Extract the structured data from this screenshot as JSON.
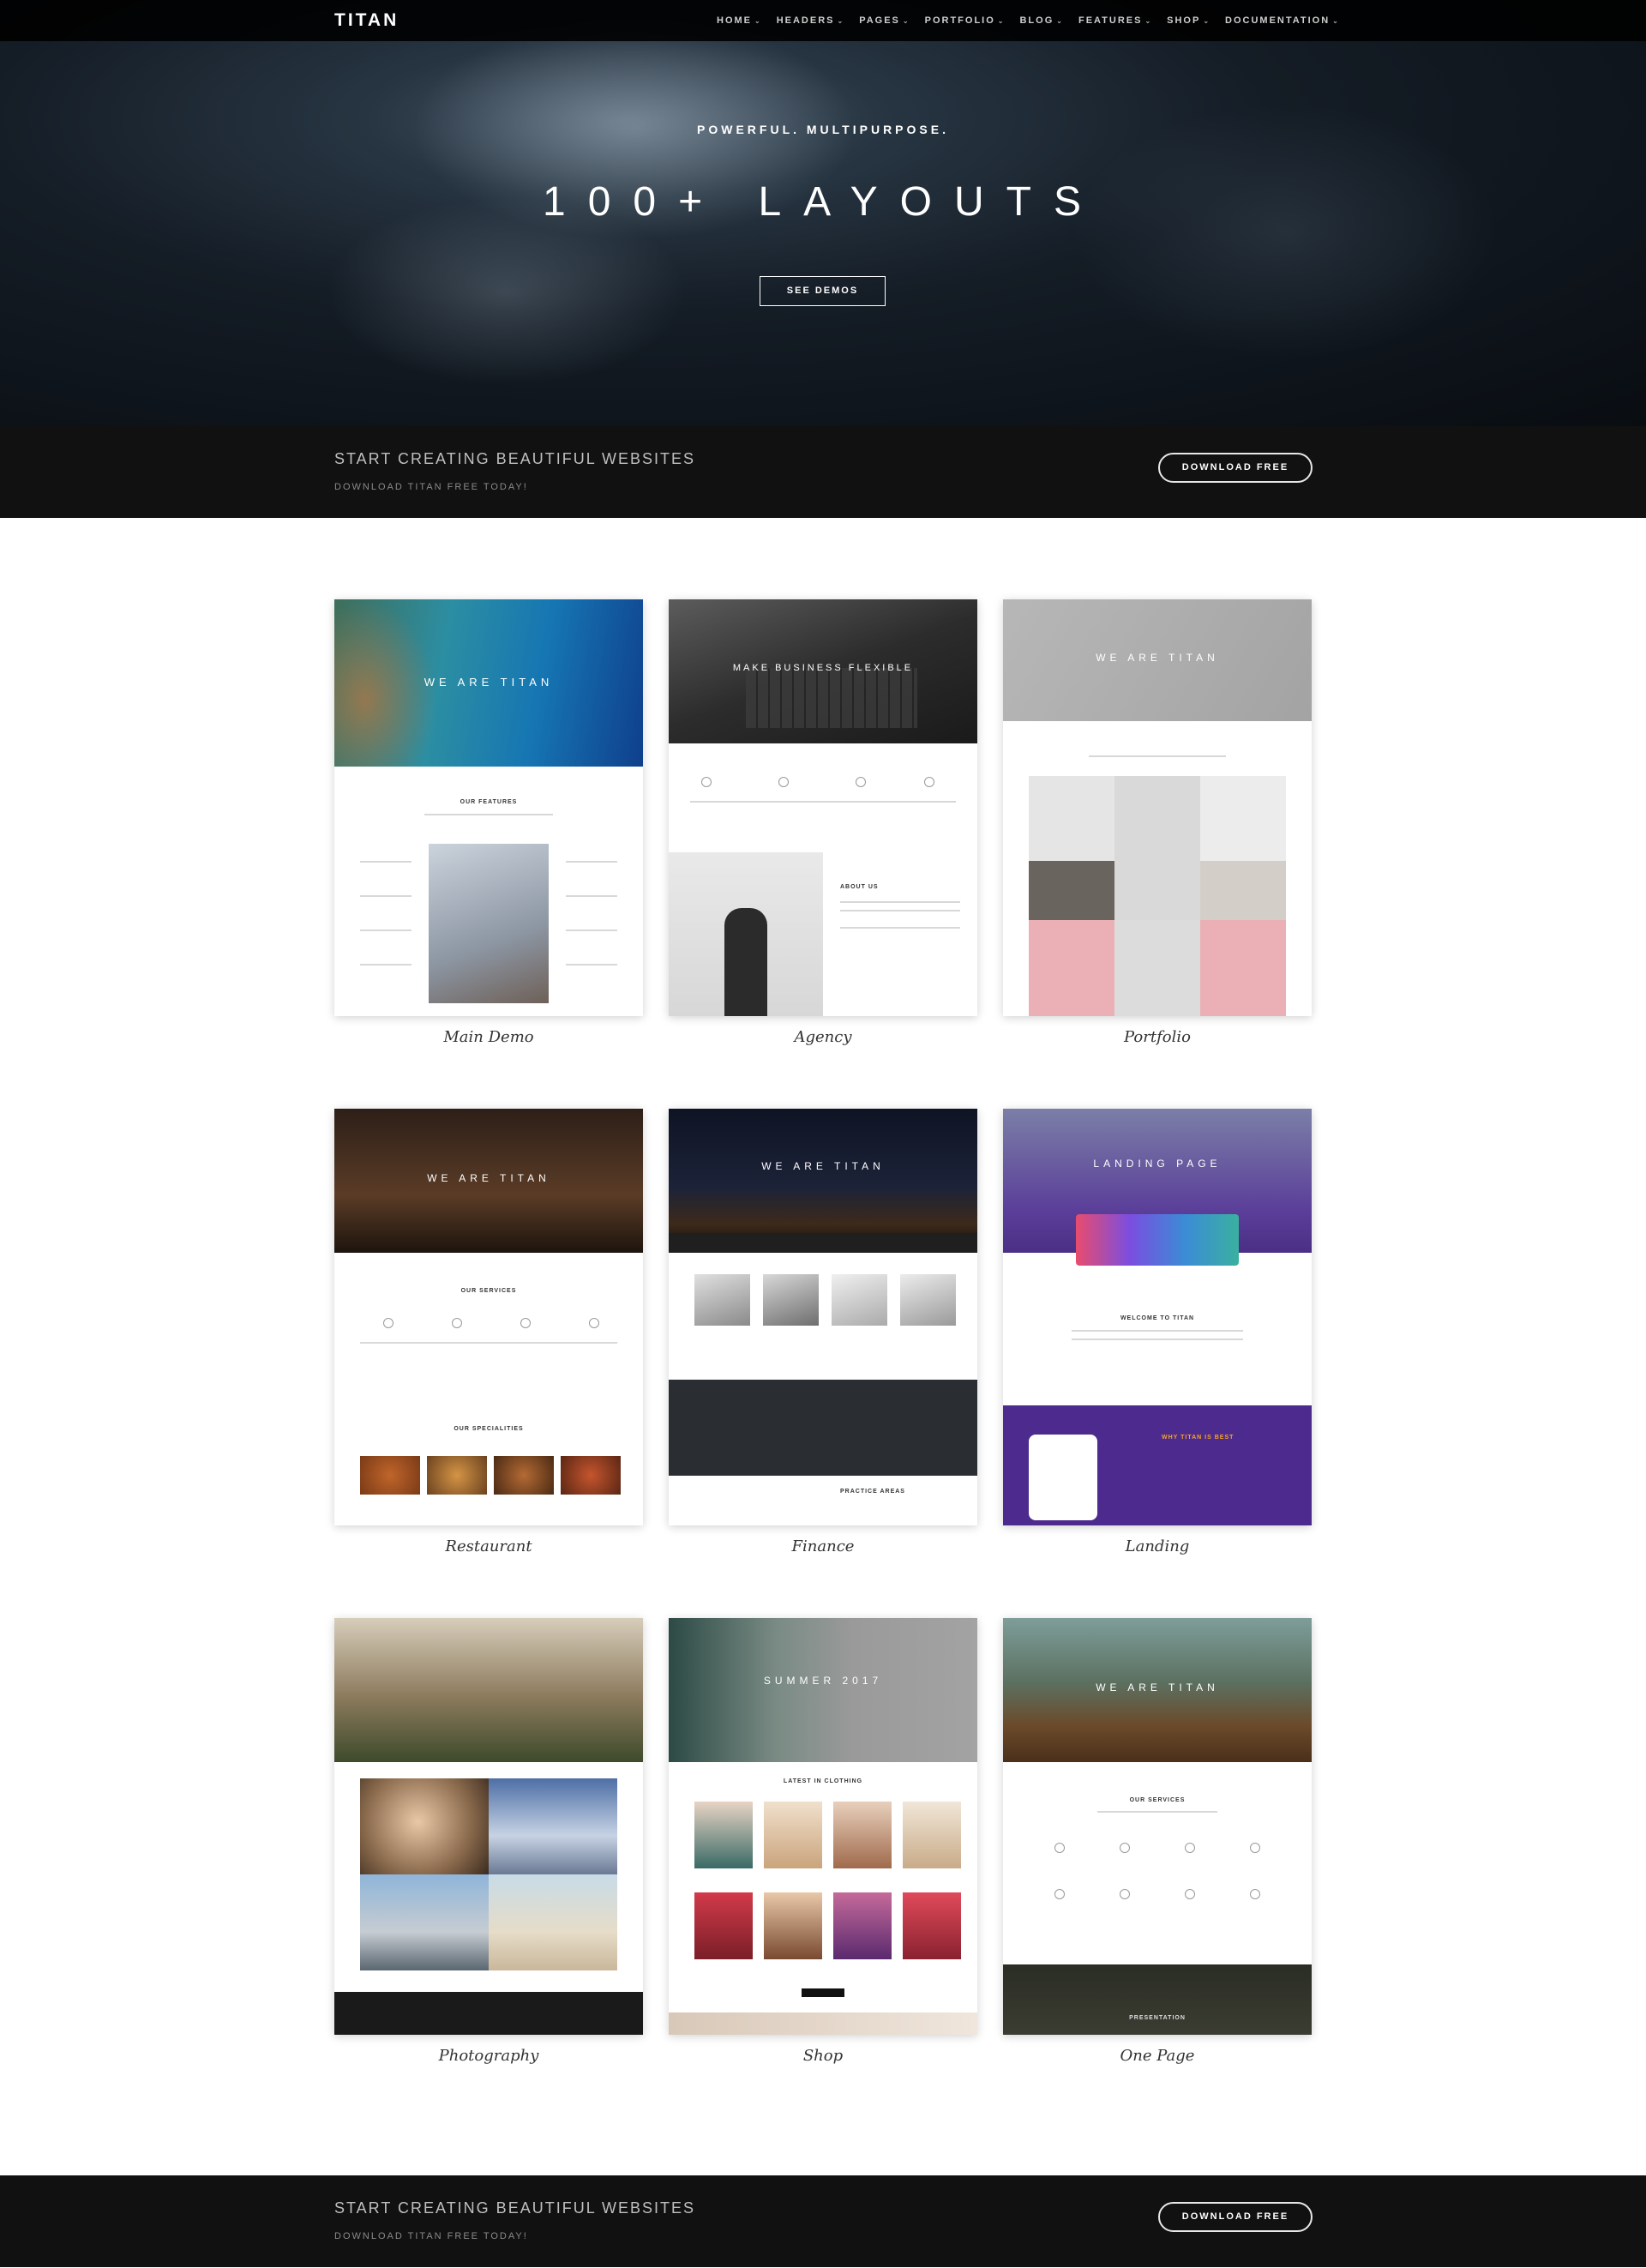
{
  "nav": {
    "logo": "TITAN",
    "items": [
      {
        "label": "HOME"
      },
      {
        "label": "HEADERS"
      },
      {
        "label": "PAGES"
      },
      {
        "label": "PORTFOLIO"
      },
      {
        "label": "BLOG"
      },
      {
        "label": "FEATURES"
      },
      {
        "label": "SHOP"
      },
      {
        "label": "DOCUMENTATION"
      }
    ]
  },
  "hero": {
    "subtitle": "POWERFUL. MULTIPURPOSE.",
    "title": "100+ LAYOUTS",
    "button": "SEE DEMOS"
  },
  "cta": {
    "title": "START CREATING BEAUTIFUL WEBSITES",
    "subtitle": "DOWNLOAD TITAN FREE TODAY!",
    "button": "DOWNLOAD FREE"
  },
  "demos": [
    {
      "caption": "Main Demo",
      "hero_text": "WE ARE TITAN",
      "section": "OUR FEATURES"
    },
    {
      "caption": "Agency",
      "hero_text": "MAKE BUSINESS FLEXIBLE",
      "section": "ABOUT US"
    },
    {
      "caption": "Portfolio",
      "hero_text": "WE ARE TITAN",
      "section": ""
    },
    {
      "caption": "Restaurant",
      "hero_text": "WE ARE TITAN",
      "section": "OUR SERVICES",
      "section2": "OUR SPECIALITIES"
    },
    {
      "caption": "Finance",
      "hero_text": "WE ARE TITAN",
      "section": "PRACTICE AREAS"
    },
    {
      "caption": "Landing",
      "hero_text": "LANDING PAGE",
      "section": "WELCOME TO TITAN",
      "section2": "WHY TITAN IS BEST"
    },
    {
      "caption": "Photography",
      "hero_text": "",
      "section": ""
    },
    {
      "caption": "Shop",
      "hero_text": "SUMMER 2017",
      "section": "LATEST IN CLOTHING"
    },
    {
      "caption": "One Page",
      "hero_text": "WE ARE TITAN",
      "section": "OUR SERVICES",
      "section2": "PRESENTATION"
    }
  ],
  "colors": {
    "dark": "#111111",
    "nav": "#000000",
    "landing_purple": "#5b3f9a",
    "portfolio_pink": "#eab0b5"
  }
}
